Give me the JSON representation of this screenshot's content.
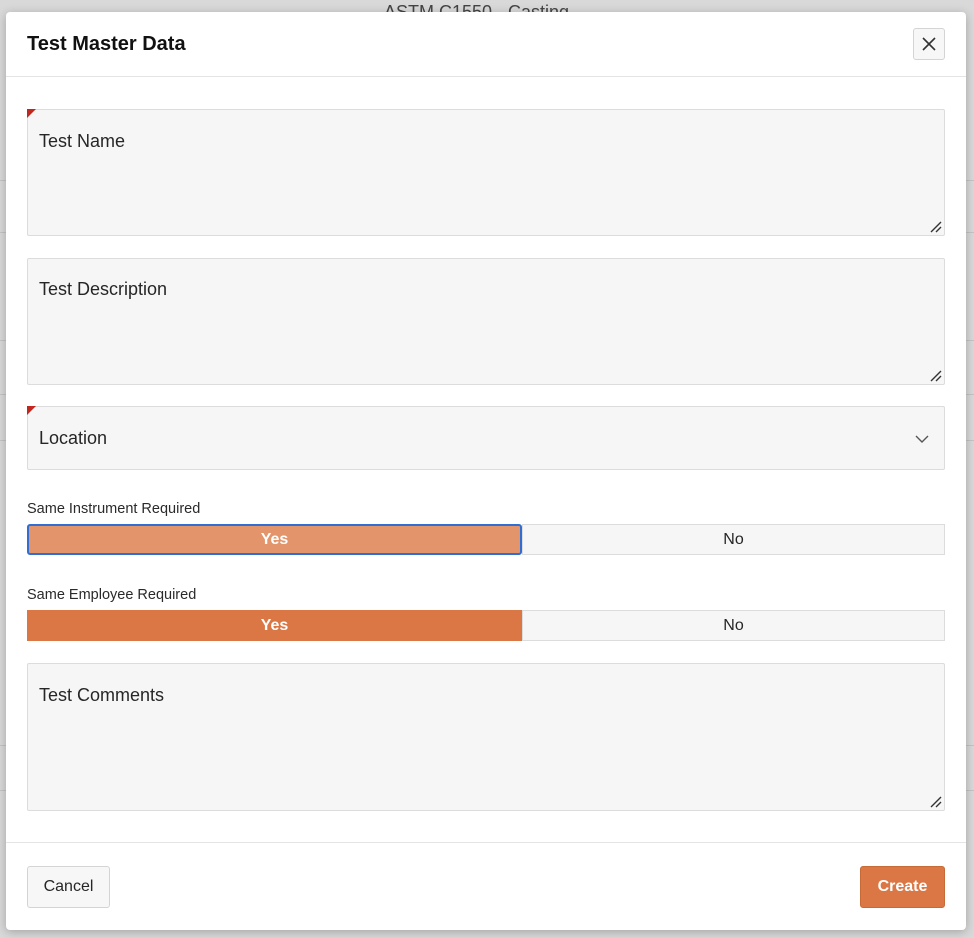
{
  "background": {
    "title": "ASTM C1550 - Casting"
  },
  "dialog": {
    "title": "Test Master Data"
  },
  "fields": {
    "test_name": {
      "label": "Test Name",
      "required": true
    },
    "test_description": {
      "label": "Test Description",
      "required": false
    },
    "location": {
      "label": "Location",
      "required": true,
      "icon": "chevron-down-icon"
    },
    "test_comments": {
      "label": "Test Comments",
      "required": false
    }
  },
  "same_instrument": {
    "label": "Same Instrument Required",
    "yes": "Yes",
    "no": "No",
    "selected": "Yes"
  },
  "same_employee": {
    "label": "Same Employee Required",
    "yes": "Yes",
    "no": "No",
    "selected": "Yes"
  },
  "footer": {
    "cancel_label": "Cancel",
    "create_label": "Create"
  },
  "colors": {
    "accent": "#da7744",
    "required_marker": "#c0271f",
    "focus_ring": "#2f6fd4"
  }
}
